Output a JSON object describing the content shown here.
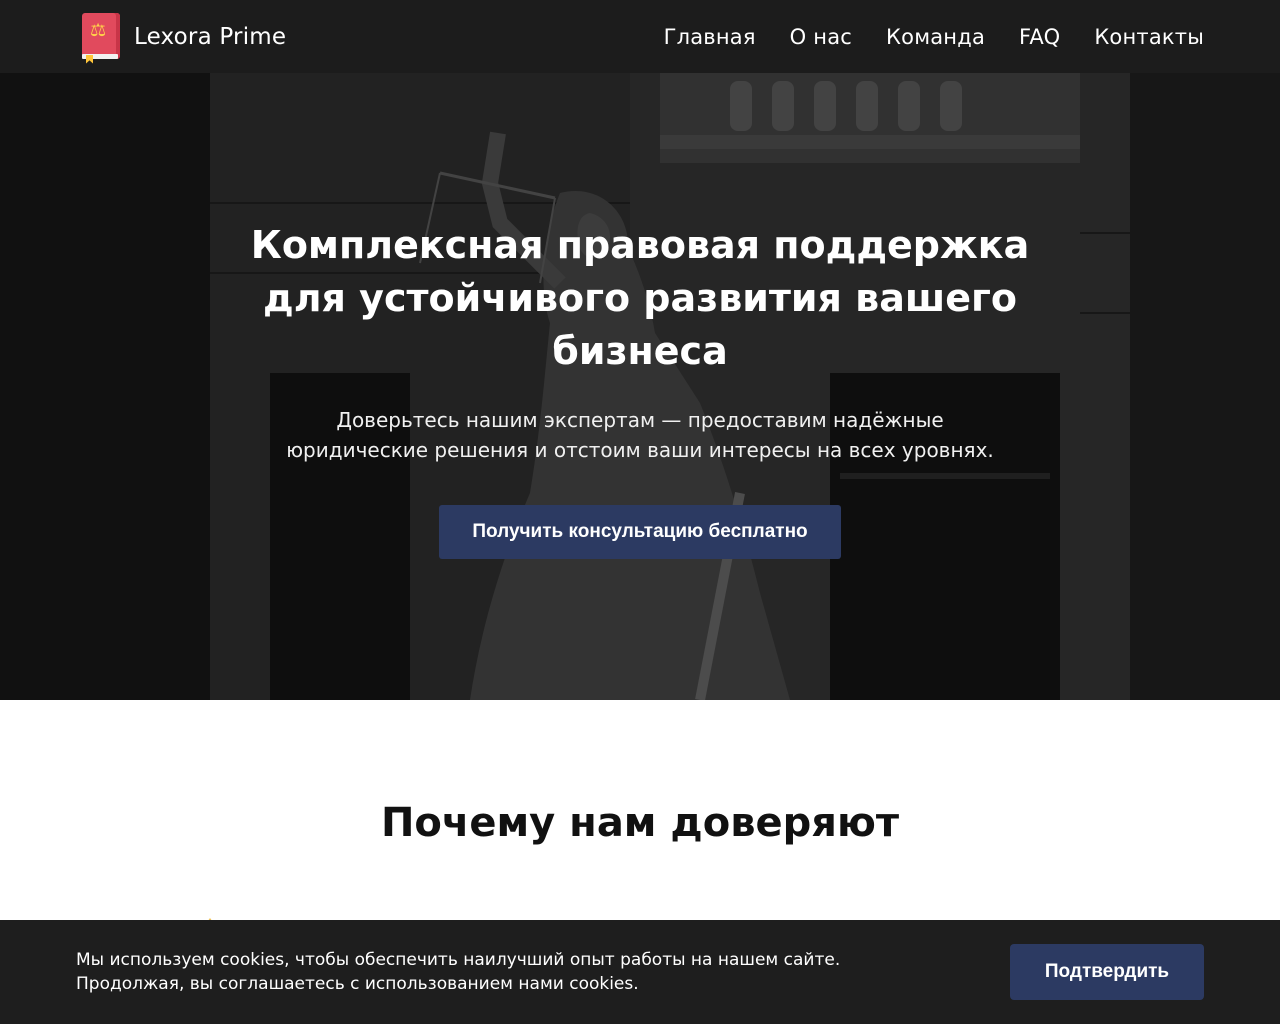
{
  "header": {
    "brand": "Lexora Prime",
    "logo_icon": "law-book-icon",
    "nav": [
      "Главная",
      "О нас",
      "Команда",
      "FAQ",
      "Контакты"
    ]
  },
  "hero": {
    "title": "Комплексная правовая поддержка для устойчивого развития вашего бизнеса",
    "subtitle": "Доверьтесь нашим экспертам — предоставим надёжные юридические решения и отстоим ваши интересы на всех уровнях.",
    "cta": "Получить консультацию бесплатно",
    "background": "justice-statue-photo"
  },
  "why": {
    "title": "Почему нам доверяют"
  },
  "cookie": {
    "text": "Мы используем cookies, чтобы обеспечить наилучший опыт работы на нашем сайте. Продолжая, вы соглашаетесь с использованием нами cookies.",
    "button": "Подтвердить"
  },
  "colors": {
    "header_bg": "#1c1c1c",
    "accent": "#2c3a62",
    "logo_red": "#e14a5d"
  }
}
